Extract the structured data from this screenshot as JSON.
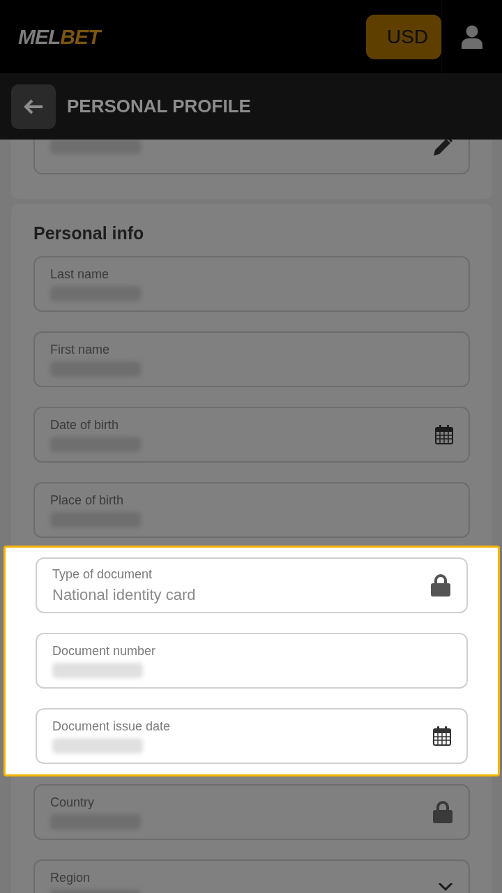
{
  "header": {
    "logo": {
      "part_1": "MEL",
      "part_2": "BET"
    },
    "currency_button": "USD"
  },
  "subheader": {
    "title": "PERSONAL PROFILE"
  },
  "email_card": {
    "field": {
      "kind": "editable",
      "redacted": true
    }
  },
  "personal_info": {
    "title": "Personal info",
    "fields": [
      {
        "kind": "text",
        "label": "Last name",
        "redacted": true
      },
      {
        "kind": "text",
        "label": "First name",
        "redacted": true
      },
      {
        "kind": "date",
        "label": "Date of birth",
        "redacted": true
      },
      {
        "kind": "text",
        "label": "Place of birth",
        "redacted": true
      }
    ],
    "highlighted_fields": [
      {
        "kind": "locked",
        "label": "Type of document",
        "value": "National identity card"
      },
      {
        "kind": "text",
        "label": "Document number",
        "redacted": true
      },
      {
        "kind": "date",
        "label": "Document issue date",
        "redacted": true
      }
    ],
    "more_fields": [
      {
        "kind": "locked",
        "label": "Country",
        "redacted": true
      },
      {
        "kind": "dropdown",
        "label": "Region",
        "redacted": true
      }
    ]
  }
}
